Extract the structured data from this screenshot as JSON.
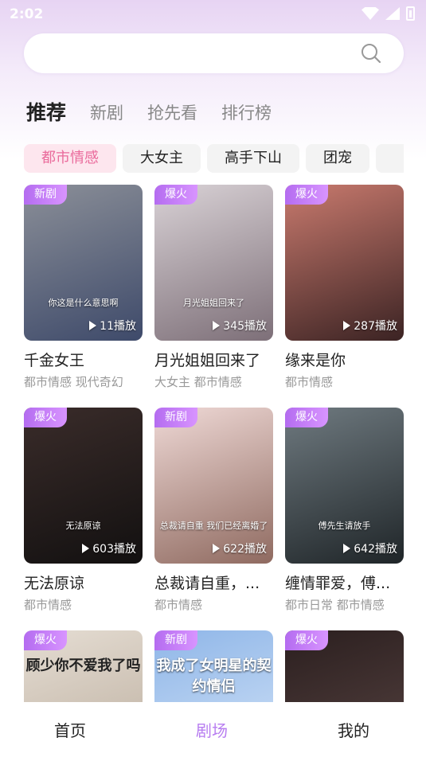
{
  "status": {
    "time": "2:02"
  },
  "search": {
    "placeholder": ""
  },
  "tabs": [
    "推荐",
    "新剧",
    "抢先看",
    "排行榜"
  ],
  "chips": [
    "都市情感",
    "大女主",
    "高手下山",
    "团宠",
    ""
  ],
  "cards": [
    {
      "badge": "新剧",
      "plays": "11播放",
      "title": "千金女王",
      "tags": "都市情感 现代奇幻",
      "poster_text": "你这是什么意思啊",
      "colors": [
        "#8b8f98",
        "#3e4a6a"
      ]
    },
    {
      "badge": "爆火",
      "plays": "345播放",
      "title": "月光姐姐回来了",
      "tags": "大女主 都市情感",
      "poster_text": "月光姐姐回来了",
      "colors": [
        "#d9d2d6",
        "#7d6f78"
      ]
    },
    {
      "badge": "爆火",
      "plays": "287播放",
      "title": "缘来是你",
      "tags": "都市情感",
      "poster_text": "",
      "colors": [
        "#c97a6e",
        "#3b2323"
      ]
    },
    {
      "badge": "爆火",
      "plays": "603播放",
      "title": "无法原谅",
      "tags": "都市情感",
      "poster_text": "无法原谅",
      "colors": [
        "#3a2c2a",
        "#121010"
      ]
    },
    {
      "badge": "新剧",
      "plays": "622播放",
      "title": "总裁请自重，...",
      "tags": "都市情感",
      "poster_text": "总裁请自重 我们已经离婚了",
      "colors": [
        "#efd9d6",
        "#8f6a60"
      ]
    },
    {
      "badge": "爆火",
      "plays": "642播放",
      "title": "缠情罪爱，傅...",
      "tags": "都市日常 都市情感",
      "poster_text": "傅先生请放手",
      "colors": [
        "#6f7a80",
        "#1f2528"
      ]
    },
    {
      "badge": "爆火",
      "plays": "",
      "title": "",
      "tags": "",
      "poster_text": "顾少你不爱我了吗",
      "colors": [
        "#e5ddd3",
        "#b8aa9a"
      ]
    },
    {
      "badge": "新剧",
      "plays": "",
      "title": "",
      "tags": "",
      "poster_text": "我成了女明星的契约情侣",
      "colors": [
        "#8fb6e8",
        "#d7e6f8"
      ]
    },
    {
      "badge": "爆火",
      "plays": "",
      "title": "",
      "tags": "",
      "poster_text": "",
      "colors": [
        "#2b1f1f",
        "#5a4644"
      ]
    }
  ],
  "nav": [
    "首页",
    "剧场",
    "我的"
  ],
  "colors": {
    "accent": "#b77cf0",
    "chip_active_text": "#ea6b9c",
    "chip_active_bg": "#fde6ee",
    "badge": "#c37ef5"
  }
}
